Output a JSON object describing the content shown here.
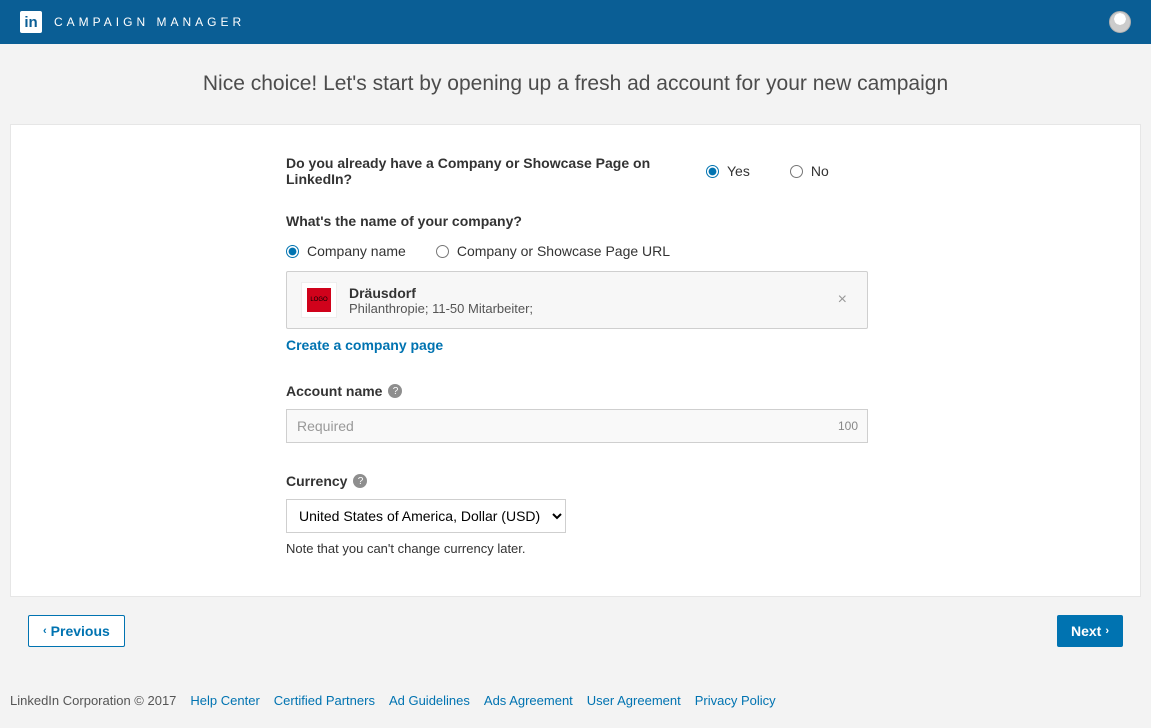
{
  "header": {
    "app_title": "CAMPAIGN MANAGER"
  },
  "heading": "Nice choice! Let's start by opening up a fresh ad account for your new campaign",
  "q1": {
    "label": "Do you already have a Company or Showcase Page on LinkedIn?",
    "yes": "Yes",
    "no": "No"
  },
  "q2": {
    "label": "What's the name of your company?",
    "opt1": "Company name",
    "opt2": "Company or Showcase Page URL"
  },
  "company": {
    "name": "Dräusdorf",
    "meta": "Philanthropie; 11-50 Mitarbeiter;",
    "create_link": "Create a company page"
  },
  "account": {
    "label": "Account name",
    "placeholder": "Required",
    "char_count": "100"
  },
  "currency": {
    "label": "Currency",
    "value": "United States of America, Dollar (USD)",
    "note": "Note that you can't change currency later."
  },
  "nav": {
    "prev": "Previous",
    "next": "Next"
  },
  "footer": {
    "copyright": "LinkedIn Corporation © 2017",
    "links": [
      "Help Center",
      "Certified Partners",
      "Ad Guidelines",
      "Ads Agreement",
      "User Agreement",
      "Privacy Policy"
    ]
  }
}
